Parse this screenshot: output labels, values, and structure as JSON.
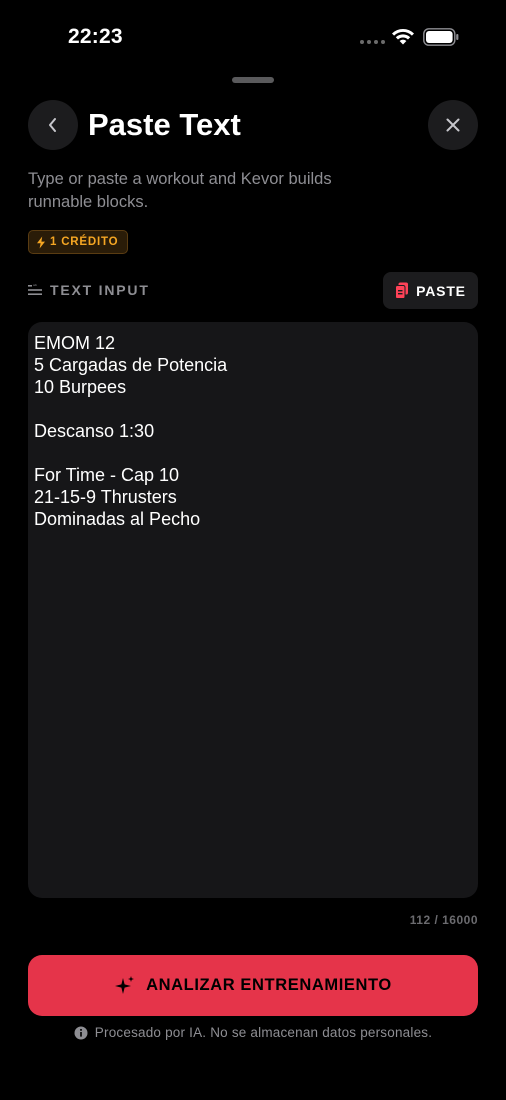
{
  "status_bar": {
    "time": "22:23"
  },
  "header": {
    "title": "Paste Text"
  },
  "subtitle": "Type or paste a workout and Kevor builds runnable blocks.",
  "credit_badge": {
    "label": "1 CRÉDITO",
    "color": "#f5a623"
  },
  "input_section": {
    "label": "TEXT INPUT",
    "paste_label": "PASTE",
    "value": "EMOM 12\n5 Cargadas de Potencia\n10 Burpees\n\nDescanso 1:30\n\nFor Time - Cap 10\n21-15-9 Thrusters\nDominadas al Pecho",
    "char_count": "112 / 16000"
  },
  "analyze_button": {
    "label": "ANALIZAR ENTRENAMIENTO",
    "color": "#e5344a"
  },
  "footer_note": "Procesado por IA. No se almacenan datos personales.",
  "icons": {
    "back": "chevron-left-icon",
    "close": "close-icon",
    "credit": "bolt-icon",
    "section": "text-lines-icon",
    "paste": "clipboard-icon",
    "analyze": "sparkle-icon",
    "info": "info-icon"
  }
}
